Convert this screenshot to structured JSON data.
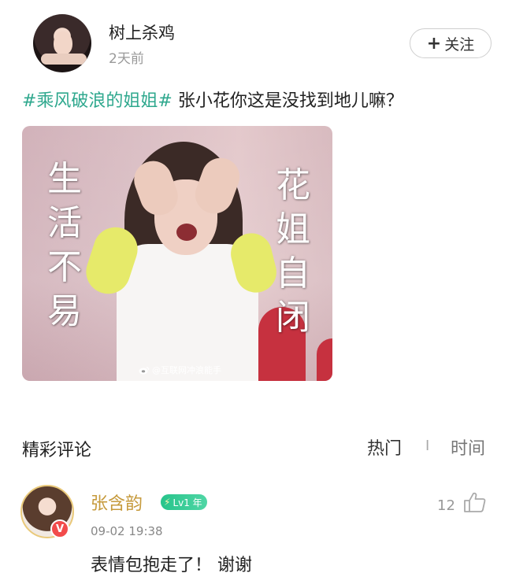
{
  "post": {
    "author": "树上杀鸡",
    "time": "2天前",
    "follow_label": "关注",
    "hashtag": "#乘风破浪的姐姐#",
    "text": " 张小花你这是没找到地儿嘛？",
    "image": {
      "caption_left": "生活不易",
      "caption_right": "花姐自闭",
      "watermark": "@互联网冲浪能手"
    }
  },
  "comments_section": {
    "title": "精彩评论",
    "sort_hot": "热门",
    "sort_divider": "I",
    "sort_time": "时间",
    "items": [
      {
        "user": "张含韵",
        "level": "Lv1 年",
        "verified": "V",
        "date": "09-02 19:38",
        "text": "表情包抱走了！ 谢谢",
        "likes": "12"
      }
    ]
  },
  "colors": {
    "hashtag": "#2fa88e",
    "vip_name": "#c69a3c",
    "level_badge": "#27c48b",
    "verified_badge": "#f24b4b"
  },
  "icons": {
    "follow": "plus-icon",
    "like": "thumbs-up-icon",
    "watermark": "weibo-icon",
    "level": "lightning-icon"
  }
}
